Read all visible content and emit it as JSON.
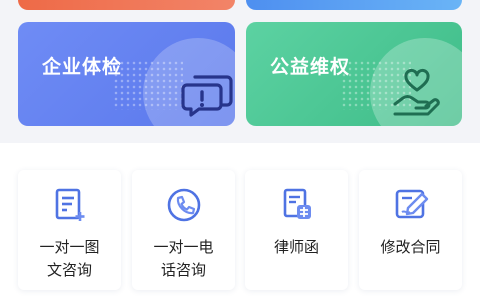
{
  "features": [
    {
      "title": "企业体检",
      "icon": "chat-question-icon"
    },
    {
      "title": "公益维权",
      "icon": "hand-heart-icon"
    }
  ],
  "services": [
    {
      "label": "一对一图\n文咨询",
      "icon": "document-add-icon"
    },
    {
      "label": "一对一电\n话咨询",
      "icon": "phone-icon"
    },
    {
      "label": "律师函",
      "icon": "lawyer-letter-icon"
    },
    {
      "label": "修改合同",
      "icon": "contract-edit-icon"
    }
  ],
  "colors": {
    "blue_card": "#5a78ec",
    "green_card": "#3ebc88",
    "icon_blue": "#4f73e3"
  }
}
